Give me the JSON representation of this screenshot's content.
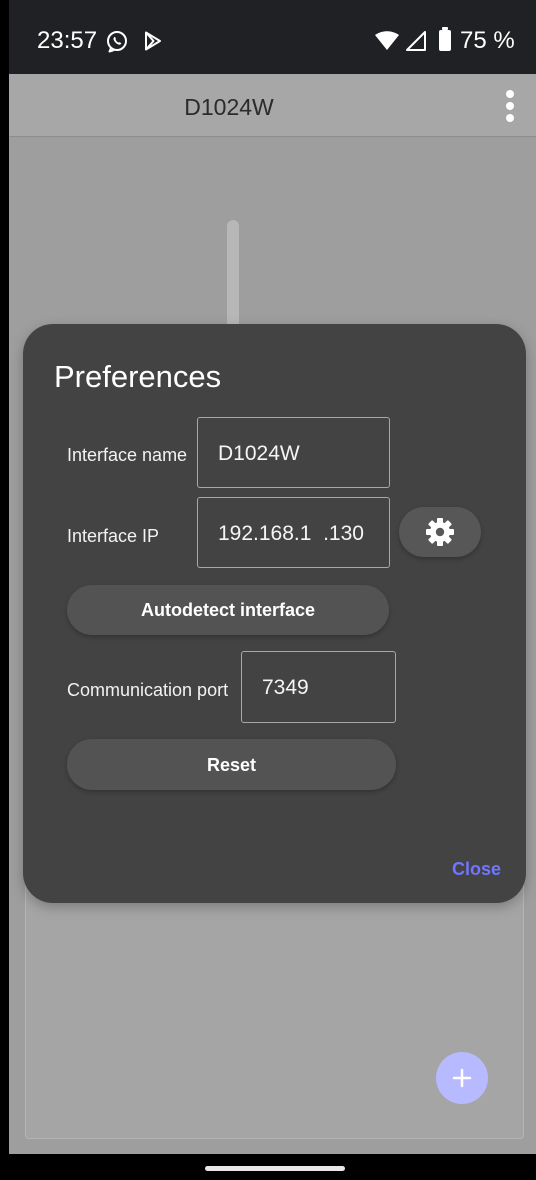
{
  "status_bar": {
    "time": "23:57",
    "battery": "75 %",
    "icons": [
      "whatsapp-icon",
      "play-store-icon",
      "wifi-icon",
      "signal-icon",
      "battery-icon"
    ]
  },
  "app_bar": {
    "title": "D1024W",
    "menu_icon": "more-vertical-icon"
  },
  "dialog": {
    "title": "Preferences",
    "interface_name_label": "Interface name",
    "interface_name_value": "D1024W",
    "interface_ip_label": "Interface IP",
    "interface_ip_value": "192.168.1  .130",
    "settings_icon": "gear-icon",
    "autodetect_label": "Autodetect interface",
    "communication_port_label": "Communication port",
    "communication_port_value": "7349",
    "reset_label": "Reset",
    "close_label": "Close"
  },
  "fab": {
    "icon": "plus-icon"
  },
  "colors": {
    "status_bar": "#202124",
    "scrim": "#9e9e9e",
    "app_bar": "#a7a7a7",
    "dialog": "#434343",
    "button": "#535353",
    "close_text": "#7076ff",
    "fab": "#b8baff"
  }
}
